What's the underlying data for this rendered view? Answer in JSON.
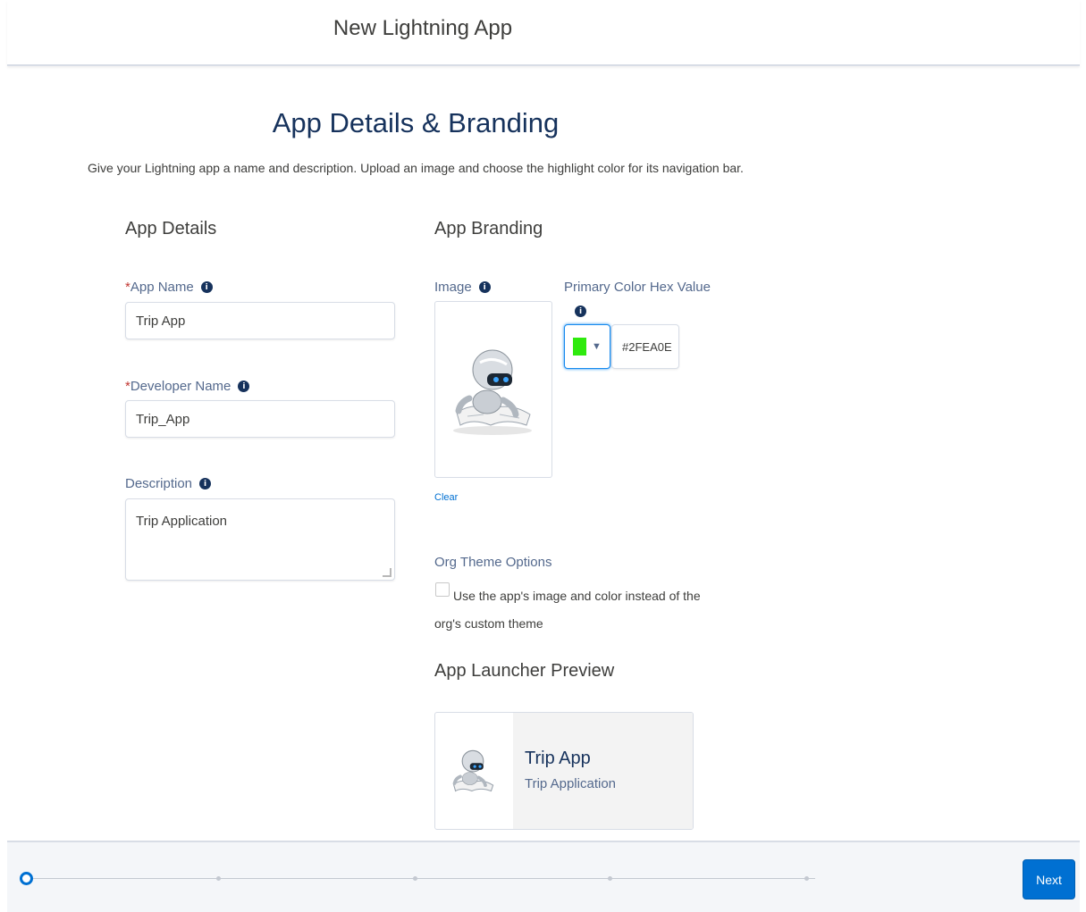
{
  "modal": {
    "title": "New Lightning App"
  },
  "section": {
    "title": "App Details & Branding",
    "subtitle": "Give your Lightning app a name and description. Upload an image and choose the highlight color for its navigation bar."
  },
  "app_details": {
    "heading": "App Details",
    "app_name": {
      "label": "App Name",
      "required_mark": "*",
      "value": "Trip App"
    },
    "developer_name": {
      "label": "Developer Name",
      "required_mark": "*",
      "value": "Trip_App"
    },
    "description": {
      "label": "Description",
      "value": "Trip Application"
    }
  },
  "app_branding": {
    "heading": "App Branding",
    "image_label": "Image",
    "clear_link": "Clear",
    "primary_color": {
      "label": "Primary Color Hex Value",
      "value": "#2FEA0E",
      "swatch_color": "#2FEA0E"
    },
    "org_theme": {
      "label": "Org Theme Options",
      "checkbox_text": "Use the app's image and color instead of the org's custom theme",
      "checked": false
    }
  },
  "launcher_preview": {
    "heading": "App Launcher Preview",
    "app_name": "Trip App",
    "app_description": "Trip Application"
  },
  "footer": {
    "next_label": "Next",
    "current_step": 1,
    "total_steps": 5
  },
  "icons": {
    "info": "info-icon",
    "dropdown": "chevron-down-icon",
    "image": "robot-mascot-icon"
  },
  "colors": {
    "brand": "#0070d2",
    "heading": "#16325c"
  }
}
